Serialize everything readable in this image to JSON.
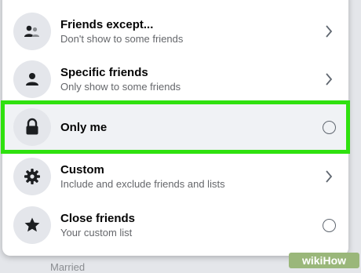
{
  "options": [
    {
      "icon": "friends-except-icon",
      "title": "Friends except...",
      "subtitle": "Don't show to some friends",
      "control": "chevron"
    },
    {
      "icon": "person-icon",
      "title": "Specific friends",
      "subtitle": "Only show to some friends",
      "control": "chevron"
    },
    {
      "icon": "lock-icon",
      "title": "Only me",
      "subtitle": "",
      "control": "radio",
      "highlighted": true
    },
    {
      "icon": "gear-icon",
      "title": "Custom",
      "subtitle": "Include and exclude friends and lists",
      "control": "chevron"
    },
    {
      "icon": "star-icon",
      "title": "Close friends",
      "subtitle": "Your custom list",
      "control": "radio"
    }
  ],
  "background_text": "Married",
  "watermark": {
    "part1": "wiki",
    "part2": "How"
  },
  "colors": {
    "highlight": "#2fe10f",
    "icon_bg": "#e4e6eb",
    "icon": "#1c1e21"
  }
}
